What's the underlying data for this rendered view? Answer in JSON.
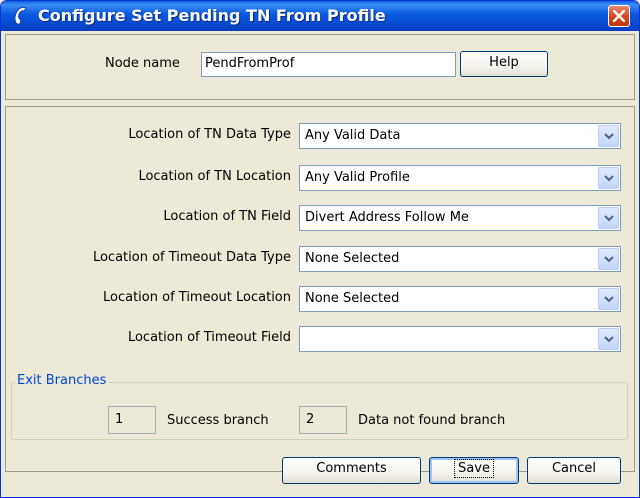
{
  "window": {
    "title": "Configure Set Pending TN From Profile"
  },
  "node": {
    "label": "Node name",
    "value": "PendFromProf",
    "help_label": "Help"
  },
  "fields": [
    {
      "label": "Location of TN Data Type",
      "value": "Any Valid Data"
    },
    {
      "label": "Location of TN Location",
      "value": "Any Valid Profile"
    },
    {
      "label": "Location of TN Field",
      "value": "Divert Address Follow Me"
    },
    {
      "label": "Location of Timeout Data Type",
      "value": "None Selected"
    },
    {
      "label": "Location of Timeout Location",
      "value": "None Selected"
    },
    {
      "label": "Location of Timeout Field",
      "value": ""
    }
  ],
  "exit_branches": {
    "title": "Exit Branches",
    "branches": [
      {
        "number": "1",
        "label": "Success branch"
      },
      {
        "number": "2",
        "label": "Data not found branch"
      }
    ]
  },
  "buttons": {
    "comments": "Comments",
    "save": "Save",
    "cancel": "Cancel"
  },
  "colors": {
    "title_bar": "#0a58e0",
    "close_button": "#d5431c",
    "dialog_bg": "#ece9d8",
    "group_title": "#0046d5"
  }
}
